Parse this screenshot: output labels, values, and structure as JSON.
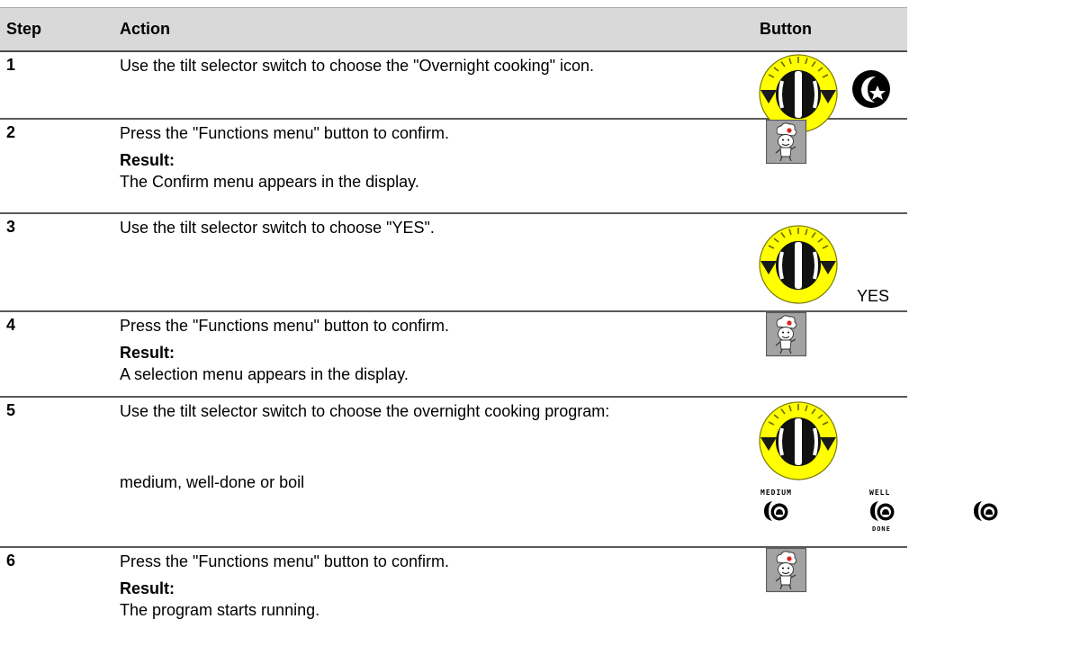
{
  "table": {
    "headers": {
      "step": "Step",
      "action": "Action",
      "button": "Button"
    },
    "rows": [
      {
        "step": "1",
        "action": "Use the tilt selector switch to choose the \"Overnight cooking\" icon.",
        "buttons": [
          "tilt-selector-switch",
          "overnight-cooking-icon"
        ]
      },
      {
        "step": "2",
        "action": "Press the \"Functions menu\" button to confirm.",
        "result_label": "Result:",
        "result": "The Confirm menu appears in the display.",
        "buttons": [
          "functions-menu-button"
        ]
      },
      {
        "step": "3",
        "action": "Use the tilt selector switch to choose \"YES\".",
        "button_caption": "YES",
        "buttons": [
          "tilt-selector-switch"
        ]
      },
      {
        "step": "4",
        "action": "Press the \"Functions menu\" button to confirm.",
        "result_label": "Result:",
        "result": "A selection menu appears in the display.",
        "buttons": [
          "functions-menu-button"
        ]
      },
      {
        "step": "5",
        "action": "Use the tilt selector switch to choose the overnight cooking program:",
        "action2": "medium, well-done or boil",
        "buttons": [
          "tilt-selector-switch",
          "medium-program-icon",
          "well-done-program-icon",
          "boil-program-icon"
        ],
        "icon_labels": {
          "medium": "MEDIUM",
          "well": "WELL",
          "done": "DONE"
        }
      },
      {
        "step": "6",
        "action": "Press the \"Functions menu\" button to confirm.",
        "result_label": "Result:",
        "result": "The program starts running.",
        "buttons": [
          "functions-menu-button"
        ]
      }
    ]
  },
  "colors": {
    "header_bg": "#d9d9d9",
    "dial_yellow": "#ffff00",
    "dial_dark": "#1a1a1a",
    "button_bg": "#9a9a9a",
    "chef_red": "#e0201b"
  }
}
